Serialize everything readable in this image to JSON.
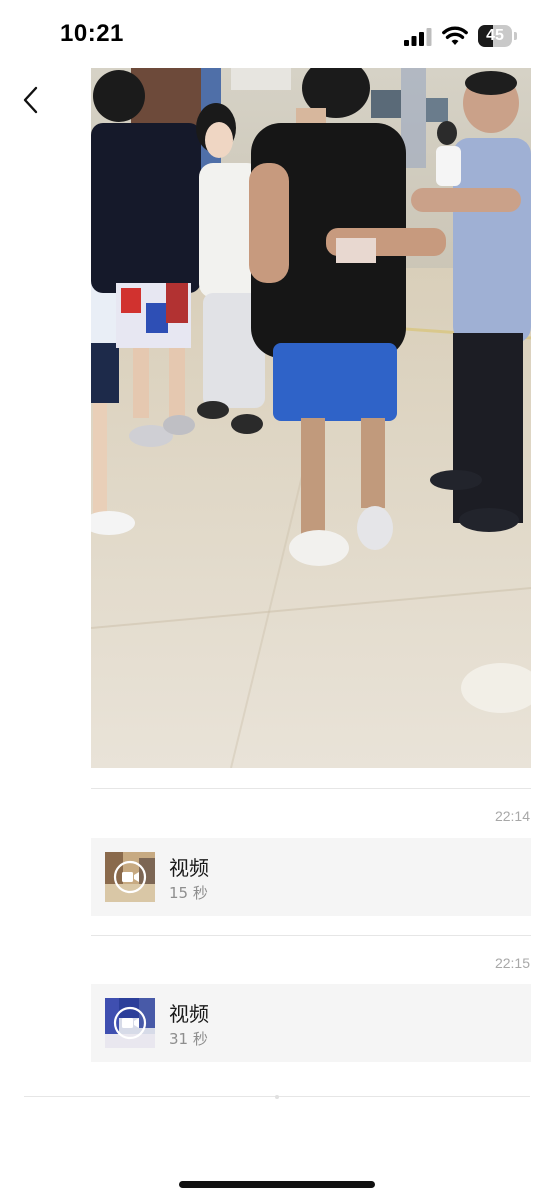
{
  "status_bar": {
    "time": "10:21",
    "battery_level": "45",
    "battery_fraction": 0.45
  },
  "nav": {
    "back_icon": "chevron-left-icon",
    "more_icon": "ellipsis-icon"
  },
  "photo": {
    "description_icon": "photo"
  },
  "messages": [
    {
      "time": "22:14",
      "title": "视频",
      "duration": "15 秒"
    },
    {
      "time": "22:15",
      "title": "视频",
      "duration": "31 秒"
    }
  ],
  "colors": {
    "card_background": "#f5f5f5",
    "secondary_text": "#8e8e8e",
    "timestamp_text": "#a8a8a8"
  }
}
